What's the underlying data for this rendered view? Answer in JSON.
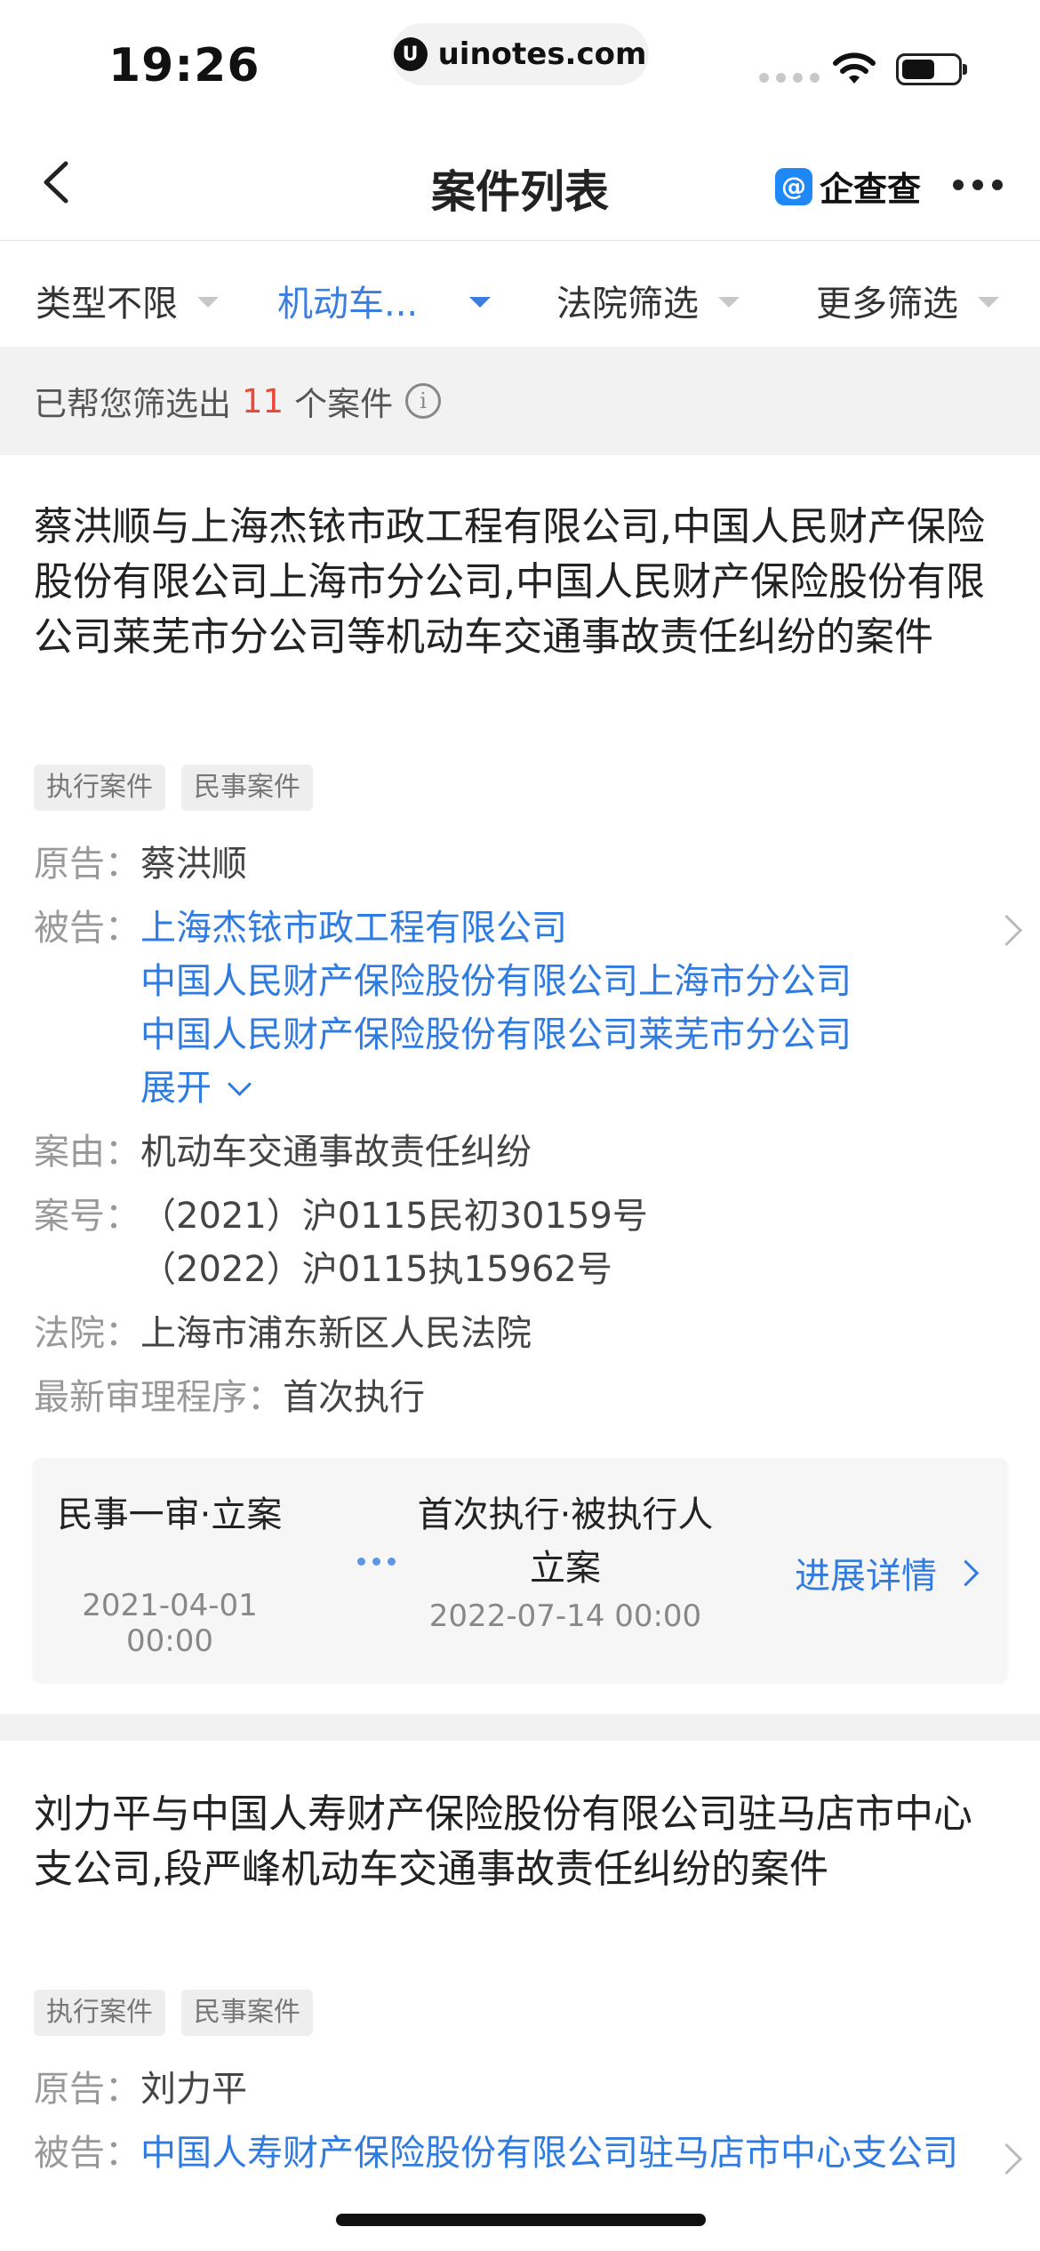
{
  "status_bar": {
    "time": "19:26",
    "url": "uinotes.com"
  },
  "nav": {
    "title": "案件列表",
    "brand": "企查查"
  },
  "filters": [
    {
      "label": "类型不限"
    },
    {
      "label": "机动车..."
    },
    {
      "label": "法院筛选"
    },
    {
      "label": "更多筛选"
    }
  ],
  "summary": {
    "prefix": "已帮您筛选出",
    "count": "11",
    "suffix": "个案件"
  },
  "labels": {
    "plaintiff": "原告：",
    "defendant": "被告：",
    "cause": "案由：",
    "case_no": "案号：",
    "court": "法院：",
    "latest_procedure": "最新审理程序：",
    "expand": "展开",
    "progress_detail": "进展详情"
  },
  "cases": [
    {
      "title": "蔡洪顺与上海杰铱市政工程有限公司,中国人民财产保险股份有限公司上海市分公司,中国人民财产保险股份有限公司莱芜市分公司等机动车交通事故责任纠纷的案件",
      "tags": [
        "执行案件",
        "民事案件"
      ],
      "plaintiff": "蔡洪顺",
      "defendants": [
        "上海杰铱市政工程有限公司",
        "中国人民财产保险股份有限公司上海市分公司",
        "中国人民财产保险股份有限公司莱芜市分公司"
      ],
      "cause": "机动车交通事故责任纠纷",
      "case_numbers": [
        "（2021）沪0115民初30159号",
        "（2022）沪0115执15962号"
      ],
      "court": "上海市浦东新区人民法院",
      "latest_procedure": "首次执行",
      "progress": [
        {
          "name": "民事一审·立案",
          "date": "2021-04-01 00:00"
        },
        {
          "name_line1": "首次执行·被执行人",
          "name_line2": "立案",
          "date": "2022-07-14 00:00"
        }
      ]
    },
    {
      "title": "刘力平与中国人寿财产保险股份有限公司驻马店市中心支公司,段严峰机动车交通事故责任纠纷的案件",
      "tags": [
        "执行案件",
        "民事案件"
      ],
      "plaintiff": "刘力平",
      "defendants": [
        "中国人寿财产保险股份有限公司驻马店市中心支公司"
      ]
    }
  ]
}
